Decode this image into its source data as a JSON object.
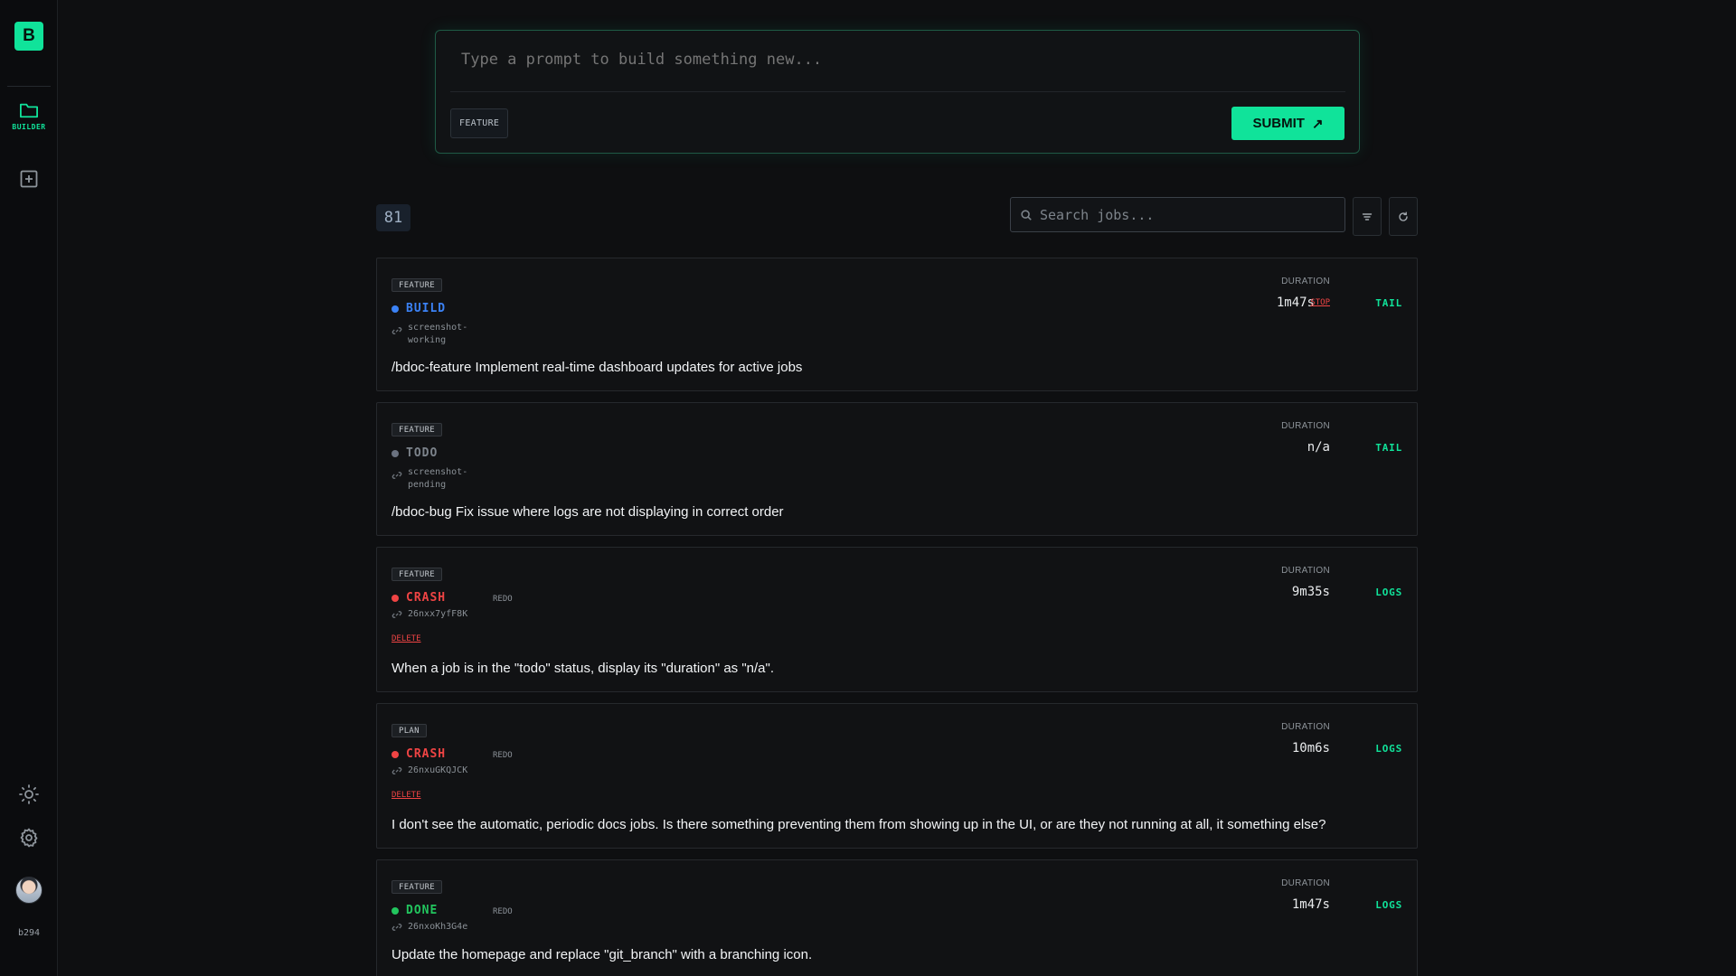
{
  "app": {
    "logo_letter": "B",
    "version": "b294",
    "accent": "#10e39a"
  },
  "sidebar": {
    "builder_label": "BUILDER"
  },
  "prompt": {
    "placeholder": "Type a prompt to build something new...",
    "tag": "FEATURE",
    "submit_label": "SUBMIT",
    "submit_arrow": "↗"
  },
  "toolbar": {
    "count": "81",
    "search_placeholder": "Search jobs..."
  },
  "jobs": [
    {
      "type": "FEATURE",
      "status": "BUILD",
      "status_color": "#3b82f6",
      "branch": [
        "screenshot-",
        "working"
      ],
      "description": "/bdoc-feature Implement real-time dashboard updates for active jobs",
      "duration_label": "DURATION",
      "duration": "1m47s",
      "stop": "STOP",
      "action": "TAIL"
    },
    {
      "type": "FEATURE",
      "status": "TODO",
      "status_color": "#6b7280",
      "branch": [
        "screenshot-",
        "pending"
      ],
      "description": "/bdoc-bug Fix issue where logs are not displaying in correct order",
      "duration_label": "DURATION",
      "duration": "n/a",
      "action": "TAIL"
    },
    {
      "type": "FEATURE",
      "status": "CRASH",
      "status_color": "#ef4444",
      "redo": "REDO",
      "branch": [
        "26nxx7yfF8K"
      ],
      "delete": "DELETE",
      "description": "When a job is in the \"todo\" status, display its \"duration\" as \"n/a\".",
      "duration_label": "DURATION",
      "duration": "9m35s",
      "action": "LOGS"
    },
    {
      "type": "PLAN",
      "status": "CRASH",
      "status_color": "#ef4444",
      "redo": "REDO",
      "branch": [
        "26nxuGKQJCK"
      ],
      "delete": "DELETE",
      "description": "I don't see the automatic, periodic docs jobs. Is there something preventing them from showing up in the UI, or are they not running at all, it something else?",
      "duration_label": "DURATION",
      "duration": "10m6s",
      "action": "LOGS"
    },
    {
      "type": "FEATURE",
      "status": "DONE",
      "status_color": "#22c55e",
      "redo": "REDO",
      "branch": [
        "26nxoKh3G4e"
      ],
      "description": "Update the homepage and replace \"git_branch\" with a branching icon.",
      "duration_label": "DURATION",
      "duration": "1m47s",
      "action": "LOGS"
    }
  ]
}
